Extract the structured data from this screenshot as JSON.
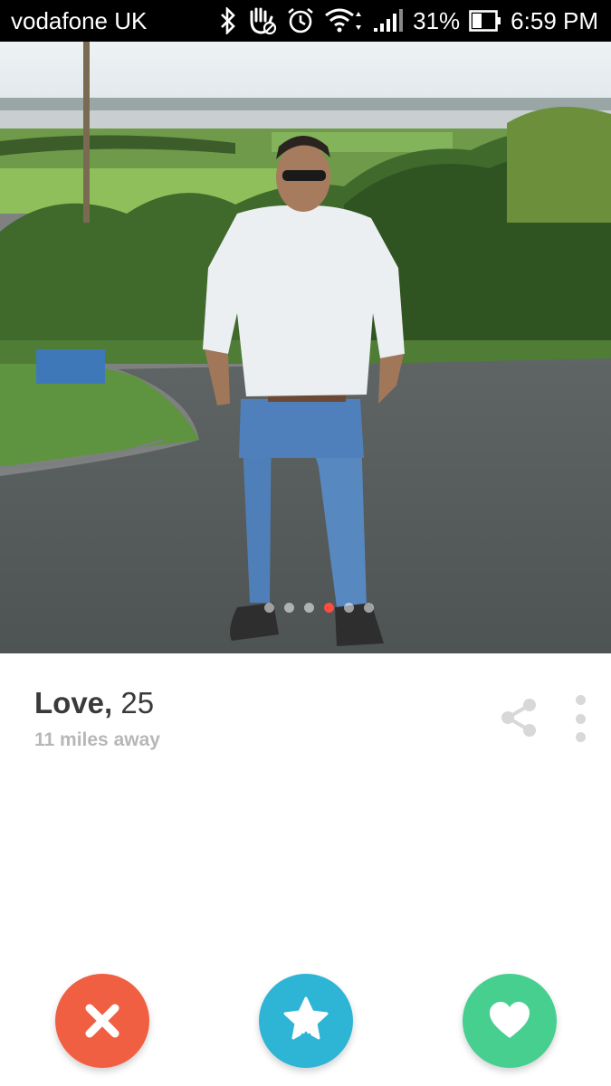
{
  "status_bar": {
    "carrier": "vodafone UK",
    "battery": "31%",
    "time": "6:59 PM",
    "icons": [
      "bluetooth-icon",
      "do-not-disturb-hand-icon",
      "alarm-icon",
      "wifi-icon",
      "signal-icon",
      "battery-icon"
    ]
  },
  "profile": {
    "name": "Love,",
    "age": "25",
    "distance": "11 miles away",
    "photo_count": 6,
    "active_photo_index": 3
  },
  "actions": {
    "nope": "close-icon",
    "superlike": "star-icon",
    "like": "heart-icon"
  },
  "colors": {
    "nope": "#f05f42",
    "superlike": "#2eb4d5",
    "like": "#47cf8f",
    "active_dot": "#ff4b40"
  }
}
